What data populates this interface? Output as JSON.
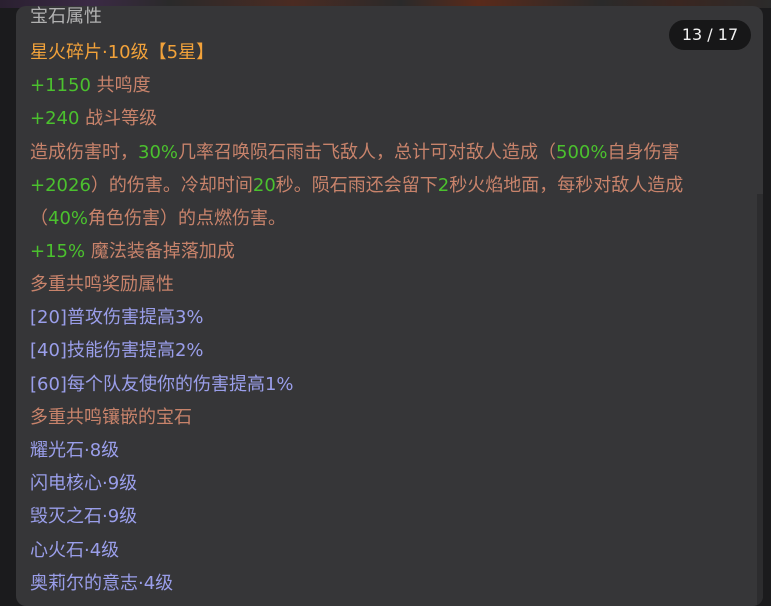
{
  "counter": "13 / 17",
  "section_title": "宝石属性",
  "gem_title": "星火碎片·10级【5星】",
  "stats": [
    {
      "num": "+1150",
      "label": " 共鸣度"
    },
    {
      "num": "+240",
      "label": " 战斗等级"
    }
  ],
  "effect": {
    "l1a": "造成伤害时，",
    "l1b": "30%",
    "l1c": "几率召唤陨石雨击飞敌人，总计可对敌人造成（",
    "l1d": "500%",
    "l1e": "自身伤害",
    "l2a": "+2026",
    "l2b": "）的伤害。冷却时间",
    "l2c": "20",
    "l2d": "秒。陨石雨还会留下",
    "l2e": "2",
    "l2f": "秒火焰地面，每秒对敌人造成",
    "l3a": "（",
    "l3b": "40%",
    "l3c": "角色伤害）的点燃伤害。"
  },
  "drop": {
    "num": "+15%",
    "label": " 魔法装备掉落加成"
  },
  "resonance_title": "多重共鸣奖励属性",
  "resonance_bonuses": [
    "[20]普攻伤害提高3%",
    "[40]技能伤害提高2%",
    "[60]每个队友使你的伤害提高1%"
  ],
  "embedded_title": "多重共鸣镶嵌的宝石",
  "embedded_gems": [
    "耀光石·8级",
    "闪电核心·9级",
    "毁灭之石·9级",
    "心火石·4级",
    "奥莉尔的意志·4级"
  ]
}
